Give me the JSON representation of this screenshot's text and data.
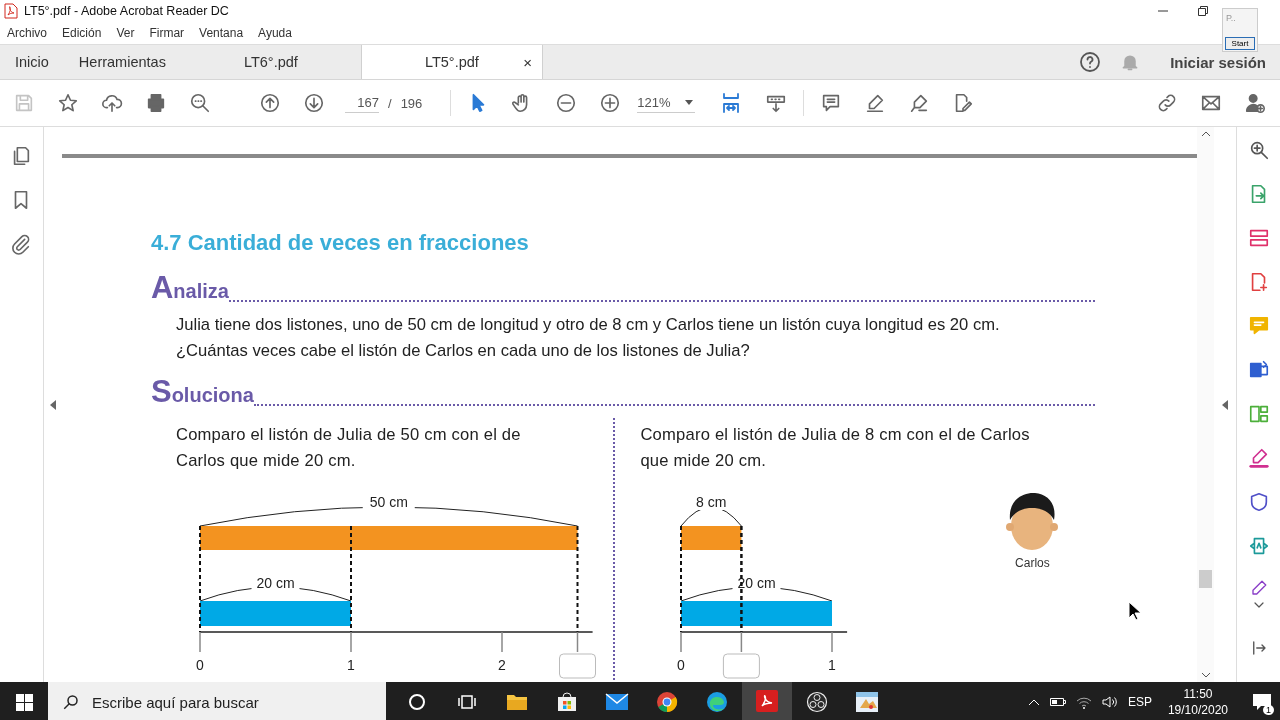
{
  "window": {
    "title": "LT5°.pdf - Adobe Acrobat Reader DC"
  },
  "popup": {
    "text": "P..",
    "button": "Start"
  },
  "menu": [
    "Archivo",
    "Edición",
    "Ver",
    "Firmar",
    "Ventana",
    "Ayuda"
  ],
  "tabs": [
    {
      "label": "Inicio",
      "kind": "nav",
      "selected": false
    },
    {
      "label": "Herramientas",
      "kind": "nav",
      "selected": false
    },
    {
      "label": "LT6°.pdf",
      "kind": "doc",
      "selected": false
    },
    {
      "label": "LT5°.pdf",
      "kind": "doc",
      "selected": true,
      "close": "×"
    }
  ],
  "account": {
    "sign_in": "Iniciar sesión"
  },
  "toolbar": {
    "page": "167",
    "separator": "/",
    "total": "196",
    "zoom": "121%"
  },
  "document": {
    "heading": "4.7 Cantidad de veces en fracciones",
    "analiza": {
      "initial": "A",
      "rest": "naliza"
    },
    "problem": "Julia tiene dos listones, uno de 50 cm de longitud y otro de 8 cm y Carlos tiene un listón cuya longitud es 20 cm. ¿Cuántas veces cabe el listón de Carlos en cada uno de los listones de Julia?",
    "soluciona": {
      "initial": "S",
      "rest": "oluciona"
    },
    "columns": [
      {
        "text": "Comparo el listón de Julia de 50 cm con el de Carlos que mide 20 cm.",
        "diagram": {
          "top_label": "50 cm",
          "bottom_label": "20 cm",
          "ticks": [
            "0",
            "1",
            "2"
          ]
        }
      },
      {
        "text": "Comparo el listón de Julia de 8 cm con el de Carlos que mide 20 cm.",
        "diagram": {
          "top_label": "8 cm",
          "bottom_label": "20 cm",
          "ticks": [
            "0",
            "1"
          ]
        }
      }
    ],
    "character": {
      "name": "Carlos"
    }
  },
  "taskbar": {
    "search_placeholder": "Escribe aquí para buscar",
    "language": "ESP",
    "time": "11:50",
    "date": "19/10/2020",
    "notifications": "1"
  }
}
